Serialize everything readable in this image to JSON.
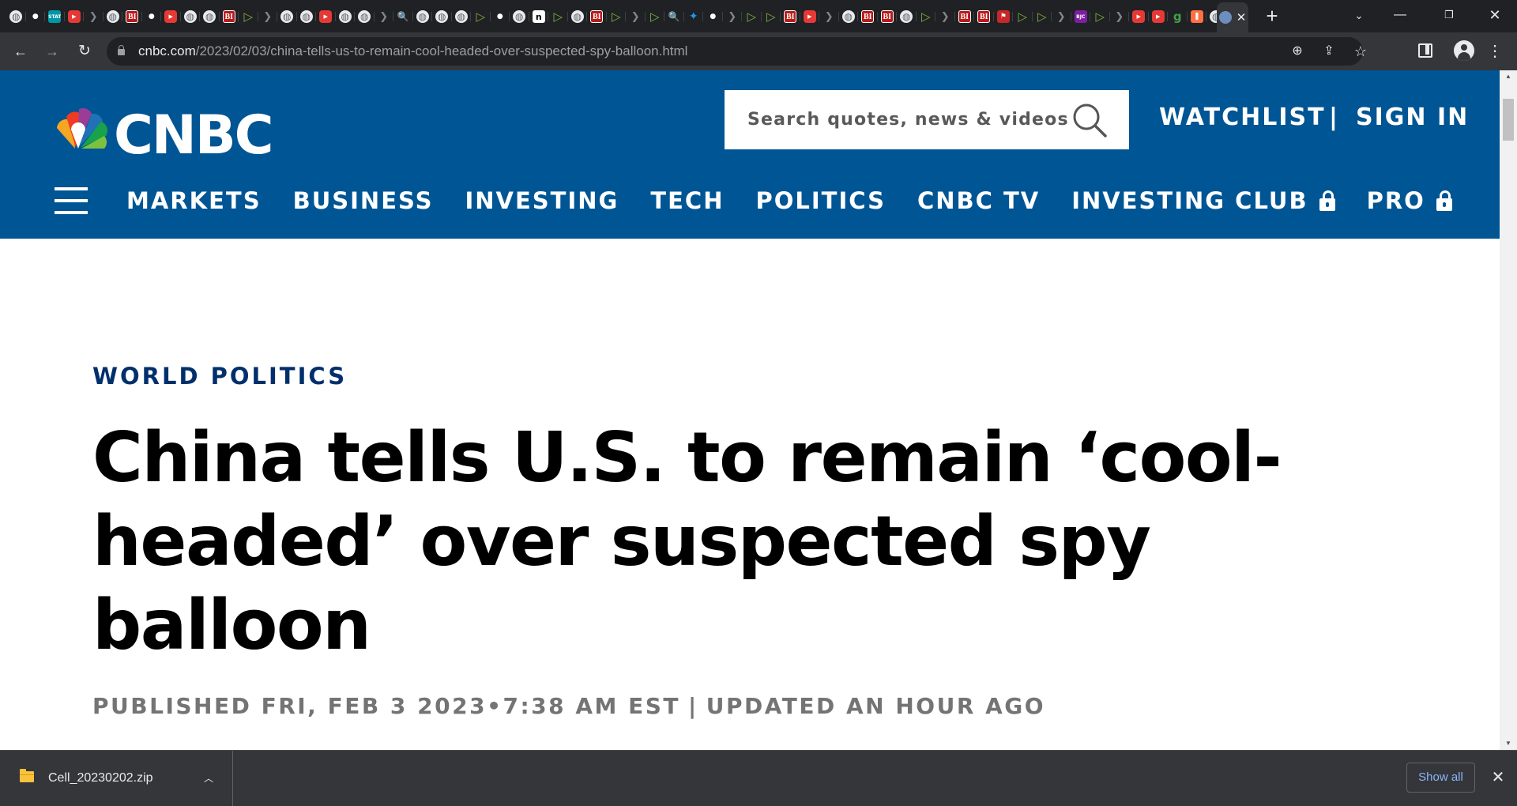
{
  "browser": {
    "tab_favicons": [
      "globe",
      "circle",
      "stat",
      "youtube",
      "chevron",
      "globe",
      "bi",
      "circle",
      "youtube",
      "globe",
      "globe",
      "bi",
      "play",
      "chevron",
      "globe",
      "globe",
      "youtube",
      "globe",
      "globe",
      "chevron",
      "search",
      "globe",
      "globe",
      "globe",
      "play",
      "circle",
      "globe",
      "n",
      "play",
      "globe",
      "bi",
      "play",
      "chevron",
      "play",
      "search",
      "bird",
      "circle",
      "chevron",
      "play",
      "play",
      "bi",
      "youtube",
      "chevron",
      "globe",
      "bi",
      "bi",
      "globe",
      "play",
      "chevron",
      "bi",
      "bi",
      "flag",
      "play",
      "play",
      "chevron",
      "bjc",
      "play",
      "chevron",
      "youtube",
      "youtube",
      "g",
      "bookmark",
      "globe"
    ],
    "active_tab_close": "✕",
    "new_tab": "+",
    "url_host": "cnbc.com",
    "url_path": "/2023/02/03/china-tells-us-to-remain-cool-headed-over-suspected-spy-balloon.html",
    "colors": {
      "frame": "#202124",
      "toolbar": "#35363a",
      "accent": "#8ab4f8"
    }
  },
  "site": {
    "brand": "CNBC",
    "brand_color": "#005594",
    "search_placeholder": "Search quotes, news & videos",
    "watchlist": "WATCHLIST",
    "divider": "|",
    "signin": "SIGN IN",
    "nav": [
      {
        "label": "MARKETS",
        "locked": false
      },
      {
        "label": "BUSINESS",
        "locked": false
      },
      {
        "label": "INVESTING",
        "locked": false
      },
      {
        "label": "TECH",
        "locked": false
      },
      {
        "label": "POLITICS",
        "locked": false
      },
      {
        "label": "CNBC TV",
        "locked": false
      },
      {
        "label": "INVESTING CLUB",
        "locked": true
      },
      {
        "label": "PRO",
        "locked": true
      }
    ]
  },
  "article": {
    "section": "WORLD POLITICS",
    "headline": "China tells U.S. to remain ‘cool-headed’ over suspected spy balloon",
    "published": "PUBLISHED FRI, FEB 3 2023•7:38 AM EST",
    "separator": "|",
    "updated": "UPDATED AN HOUR AGO",
    "section_color": "#002f6c"
  },
  "downloads": {
    "file_name": "Cell_20230202.zip",
    "show_all": "Show all"
  }
}
